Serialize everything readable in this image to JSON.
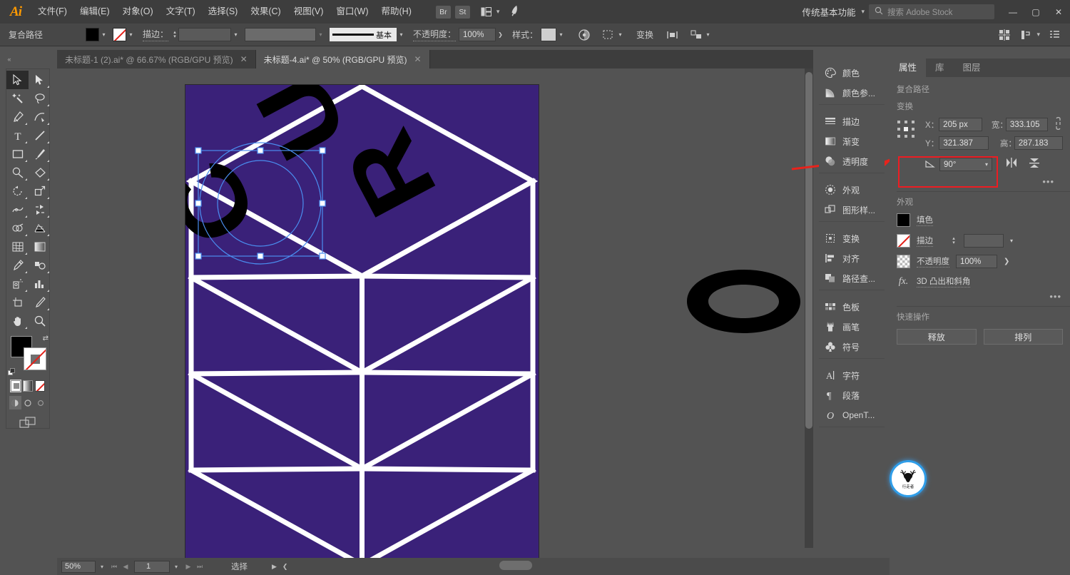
{
  "app": {
    "name": "Adobe Illustrator",
    "logo": "Ai"
  },
  "menubar": {
    "items": [
      "文件(F)",
      "编辑(E)",
      "对象(O)",
      "文字(T)",
      "选择(S)",
      "效果(C)",
      "视图(V)",
      "窗口(W)",
      "帮助(H)"
    ],
    "quick_buttons": [
      "Br",
      "St"
    ],
    "arrange_icon": "arrange-documents-icon",
    "rocket_icon": "discover-icon",
    "workspace": "传统基本功能",
    "workspace_chevron": "▾",
    "search_placeholder": "搜索 Adobe Stock",
    "search_icon": "search-icon",
    "window_controls": {
      "minimize": "—",
      "maximize": "▢",
      "close": "✕"
    }
  },
  "controlbar": {
    "selection_type": "复合路径",
    "fill_label": "fill-swatch",
    "fill_color": "#000000",
    "stroke_swatch": "none",
    "stroke_label": "描边：",
    "stroke_weight": "",
    "stroke_profile_name": "基本",
    "opacity_label": "不透明度：",
    "opacity_value": "100%",
    "style_label": "样式：",
    "recolor_icon": "recolor-artwork-icon",
    "select_similar_icon": "select-similar-icon",
    "transform_label": "变换",
    "align_icon": "align-icon",
    "distribute_icon": "distribute-icon",
    "right_icons": [
      "arrange-icon",
      "properties-icon",
      "document-setup-icon"
    ]
  },
  "tabs": [
    {
      "title": "未标题-1 (2).ai* @ 66.67% (RGB/GPU 预览)",
      "active": false,
      "close": "✕"
    },
    {
      "title": "未标题-4.ai* @ 50% (RGB/GPU 预览)",
      "active": true,
      "close": "✕"
    }
  ],
  "toolbar": {
    "tools": [
      {
        "name": "selection-tool",
        "active": true
      },
      {
        "name": "direct-selection-tool",
        "active": false
      },
      {
        "name": "magic-wand-tool",
        "active": false
      },
      {
        "name": "lasso-tool",
        "active": false
      },
      {
        "name": "pen-tool",
        "active": false
      },
      {
        "name": "curvature-tool",
        "active": false
      },
      {
        "name": "type-tool",
        "active": false
      },
      {
        "name": "line-segment-tool",
        "active": false
      },
      {
        "name": "rectangle-tool",
        "active": false
      },
      {
        "name": "paintbrush-tool",
        "active": false
      },
      {
        "name": "shaper-tool",
        "active": false
      },
      {
        "name": "eraser-tool",
        "active": false
      },
      {
        "name": "rotate-tool",
        "active": false
      },
      {
        "name": "scale-tool",
        "active": false
      },
      {
        "name": "width-tool",
        "active": false
      },
      {
        "name": "free-transform-tool",
        "active": false
      },
      {
        "name": "shape-builder-tool",
        "active": false
      },
      {
        "name": "perspective-grid-tool",
        "active": false
      },
      {
        "name": "mesh-tool",
        "active": false
      },
      {
        "name": "gradient-tool",
        "active": false
      },
      {
        "name": "eyedropper-tool",
        "active": false
      },
      {
        "name": "blend-tool",
        "active": false
      },
      {
        "name": "symbol-sprayer-tool",
        "active": false
      },
      {
        "name": "column-graph-tool",
        "active": false
      },
      {
        "name": "artboard-tool",
        "active": false
      },
      {
        "name": "slice-tool",
        "active": false
      },
      {
        "name": "hand-tool",
        "active": false
      },
      {
        "name": "zoom-tool",
        "active": false
      }
    ],
    "fill_color": "#000000",
    "stroke_color": "none",
    "swap_icon": "swap-fill-stroke-icon",
    "default_icon": "default-fill-stroke-icon",
    "paint_modes": [
      "color-mode",
      "gradient-mode",
      "none-mode"
    ],
    "screen_modes": [
      "normal-screen-mode",
      "full-screen-menu-mode",
      "full-screen-mode"
    ],
    "edit_toolbar_icon": "change-screen-mode-icon"
  },
  "dock": {
    "groups": [
      [
        {
          "label": "颜色",
          "icon": "color-panel-icon"
        },
        {
          "label": "颜色参...",
          "icon": "color-guide-icon"
        }
      ],
      [
        {
          "label": "描边",
          "icon": "stroke-panel-icon"
        },
        {
          "label": "渐变",
          "icon": "gradient-panel-icon"
        },
        {
          "label": "透明度",
          "icon": "transparency-panel-icon"
        }
      ],
      [
        {
          "label": "外观",
          "icon": "appearance-panel-icon"
        },
        {
          "label": "图形样...",
          "icon": "graphic-styles-panel-icon"
        }
      ],
      [
        {
          "label": "变换",
          "icon": "transform-panel-icon"
        },
        {
          "label": "对齐",
          "icon": "align-panel-icon"
        },
        {
          "label": "路径查...",
          "icon": "pathfinder-panel-icon"
        }
      ],
      [
        {
          "label": "色板",
          "icon": "swatches-panel-icon"
        },
        {
          "label": "画笔",
          "icon": "brushes-panel-icon"
        },
        {
          "label": "符号",
          "icon": "symbols-panel-icon"
        }
      ],
      [
        {
          "label": "字符",
          "icon": "character-panel-icon"
        },
        {
          "label": "段落",
          "icon": "paragraph-panel-icon"
        },
        {
          "label": "OpenT...",
          "icon": "opentype-panel-icon"
        }
      ]
    ]
  },
  "properties": {
    "tabs": [
      {
        "label": "属性",
        "active": true
      },
      {
        "label": "库",
        "active": false
      },
      {
        "label": "图层",
        "active": false
      }
    ],
    "object_type": "复合路径",
    "transform": {
      "title": "变换",
      "reference_point_icon": "reference-point-grid-icon",
      "x_label": "X：",
      "x_value": "205 px",
      "y_label": "Y：",
      "y_value": "321.387",
      "w_label": "宽：",
      "w_value": "333.105",
      "h_label": "高：",
      "h_value": "287.183",
      "link_icon": "unlink-proportions-icon",
      "angle_label": "angle-icon",
      "angle_value": "90°",
      "angle_chevron": "▾",
      "flip_h_icon": "flip-horizontal-icon",
      "flip_v_icon": "flip-vertical-icon",
      "more_options": "•••",
      "highlighted": true,
      "highlight_color": "#ee1c22"
    },
    "appearance": {
      "title": "外观",
      "fill_label": "填色",
      "fill_color": "#000000",
      "stroke_label": "描边",
      "stroke_color": "none",
      "stroke_weight": "",
      "opacity_label": "不透明度",
      "opacity_value": "100%",
      "opacity_arrow": "❯",
      "effect_label": "3D 凸出和斜角",
      "effect_icon": "fx-icon",
      "more_options": "•••"
    },
    "quick_actions": {
      "title": "快速操作",
      "buttons": [
        "释放",
        "排列"
      ]
    }
  },
  "statusbar": {
    "zoom": "50%",
    "zoom_chevron": "▾",
    "first_page_icon": "first-artboard-icon",
    "prev_page_icon": "prev-artboard-icon",
    "page": "1",
    "page_chevron": "▾",
    "next_page_icon": "next-artboard-icon",
    "last_page_icon": "last-artboard-icon",
    "tool_status": "选择",
    "status_arrow": "▶",
    "status_chevron": "❮"
  },
  "canvas": {
    "background_color": "#3a2179",
    "grid_color": "#ffffff",
    "letters": [
      "C",
      "U",
      "R"
    ],
    "letter_color": "#000000",
    "selection_color": "#4a8ef0",
    "floating_ellipse": "O",
    "artboard_zoom": "50%"
  },
  "annotation": {
    "arrow_color": "#e8231c",
    "arrow_name": "pointer-arrow-to-angle-field"
  },
  "badge": {
    "icon": "deer-antler-logo-icon",
    "text": "行走者",
    "ring_color": "#2f9de8"
  }
}
